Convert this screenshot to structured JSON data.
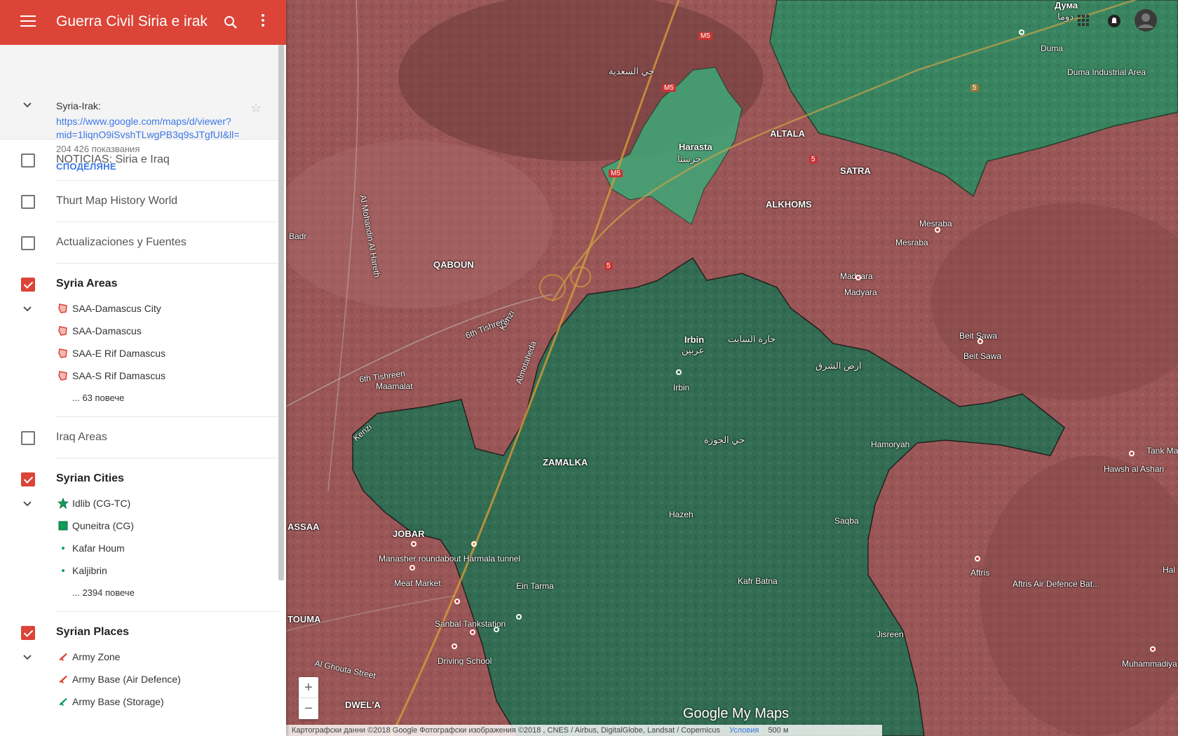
{
  "app": {
    "title": "Guerra Civil Siria e irak"
  },
  "info": {
    "description": "Syria-Irak:",
    "link_line1": "https://www.google.com/maps/d/viewer?",
    "link_line2": "mid=1liqnO9iSvshTLwgPB3q9sJTgfUI&ll=3",
    "views": "204 426 показвания",
    "share": "СПОДЕЛЯНЕ"
  },
  "layers": [
    {
      "name": "NOTICIAS: Siria e Iraq",
      "checked": false
    },
    {
      "name": "Thurt Map History World",
      "checked": false
    },
    {
      "name": "Actualizaciones y Fuentes",
      "checked": false
    },
    {
      "name": "Syria Areas",
      "checked": true
    },
    {
      "name": "Iraq Areas",
      "checked": false
    },
    {
      "name": "Syrian Cities",
      "checked": true
    },
    {
      "name": "Syrian Places",
      "checked": true
    }
  ],
  "syria_areas": {
    "items": [
      "SAA-Damascus City",
      "SAA-Damascus",
      "SAA-E Rif Damascus",
      "SAA-S Rif Damascus"
    ],
    "more": "... 63 повече"
  },
  "syrian_cities": {
    "items": [
      "Idlib (CG-TC)",
      "Quneitra (CG)",
      "Kafar Houm",
      "Kaljibrin"
    ],
    "more": "... 2394 повече"
  },
  "syrian_places": {
    "items": [
      "Army Zone",
      "Army Base (Air Defence)",
      "Army Base (Storage)"
    ]
  },
  "map": {
    "labels": {
      "duma": "Duma",
      "duma_cyr": "Дума",
      "duma_ar": "دوما",
      "duma_industrial": "Duma Industrial Area",
      "harasta": "Harasta",
      "harasta_ar": "حرستا",
      "altala": "ALTALA",
      "satra": "SATRA",
      "alkhoms": "ALKHOMS",
      "qaboun": "QABOUN",
      "mesraba": "Mesraba",
      "mesraba2": "Mesraba",
      "madyara": "Madyara",
      "madyara2": "Madyara",
      "beit_sawa": "Beit Sawa",
      "beit_sawa2": "Beit Sawa",
      "irbin": "Irbin",
      "irbin2": "Irbin",
      "zamalka": "ZAMALKA",
      "hamoryah": "Hamoryah",
      "hazeh": "Hazeh",
      "saqba": "Saqba",
      "kafr_batna": "Kafr Batna",
      "jisreen": "Jisreen",
      "ein_tarma": "Ein Tarma",
      "jobar": "JOBAR",
      "manasher": "Manasher roundabout Harmala tunnel",
      "meat_market": "Meat Market",
      "sanbal": "Sanbal Tankstation",
      "driving_school": "Driving School",
      "afris": "Aftris",
      "afris_ad": "Aftris Air Defence Bat...",
      "hawsh": "Hawsh al Ashari",
      "tank_ma": "Tank Ma",
      "muhammadiya": "Muhammadiya",
      "dwela": "DWEL'A",
      "touma": "TOUMA",
      "assaa": "ASSAA",
      "maamalat": "Maamalat",
      "sixth_tishreen": "6th Tishreen",
      "sixth_tishreen2": "6th Tishreen",
      "al_ghouta": "Al Ghouta Street",
      "kenzi": "Kenzi",
      "al_mohandin": "Al Mohandin Al Hareth",
      "al_hakim": "Almotaheda",
      "m5": "M5",
      "five": "5",
      "badr": "Badr",
      "hal": "Hal",
      "irbin_ar": "عربين",
      "ar_sabte": "حارة السابت",
      "ar_shark": "ارض الشرق",
      "ar_jouzeh": "حي الجوزة",
      "ar_saadieh": "حي السعدية"
    },
    "colors": {
      "saa_red": "#a04848",
      "rebel_green": "#2f7a5a",
      "rebel_green_light": "#3e9a70"
    }
  },
  "footer": {
    "attribution": "Картографски данни ©2018 Google Фотографски изображения ©2018 , CNES / Airbus, DigitalGlobe, Landsat / Copernicus",
    "terms": "Условия",
    "scale": "500 м"
  },
  "logo": "Google My Maps",
  "zoom": {
    "in": "+",
    "out": "−"
  }
}
